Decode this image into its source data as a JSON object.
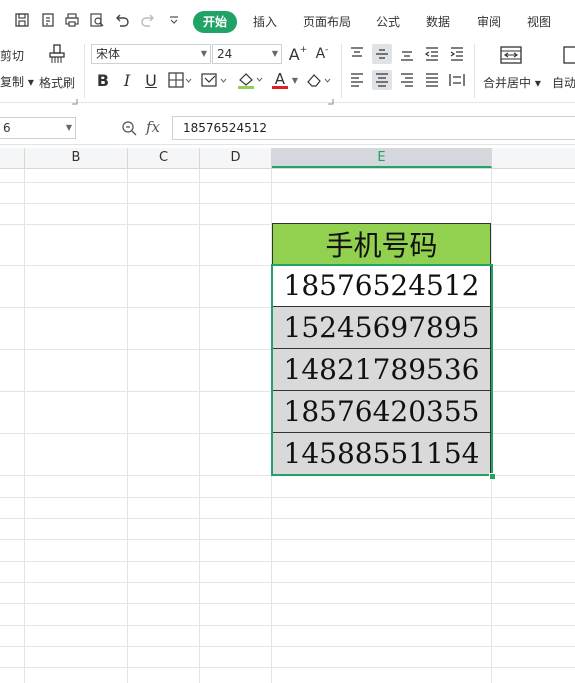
{
  "menu": {
    "tabs": [
      "开始",
      "插入",
      "页面布局",
      "公式",
      "数据",
      "审阅",
      "视图"
    ],
    "active_tab": "开始"
  },
  "ribbon": {
    "cut_label": "剪切",
    "copy_label": "复制",
    "format_painter_label": "格式刷",
    "font_name": "宋体",
    "font_size": "24",
    "bold": "B",
    "italic": "I",
    "underline": "U",
    "font_color_glyph": "A",
    "increase_font": "A⁺",
    "decrease_font": "A⁻",
    "merge_center_label": "合并居中",
    "wrap_label": "自动"
  },
  "formula_bar": {
    "name_box": "6",
    "fx_label": "fx",
    "value": "18576524512"
  },
  "columns": [
    "B",
    "C",
    "D",
    "E"
  ],
  "selected_column": "E",
  "table": {
    "header": "手机号码",
    "rows": [
      "18576524512",
      "15245697895",
      "14821789536",
      "18576420355",
      "14588551154"
    ]
  },
  "colors": {
    "accent": "#21a366",
    "header_fill": "#92d050",
    "selection_fill": "#d9d9d9",
    "active_fill": "#ffffff"
  }
}
